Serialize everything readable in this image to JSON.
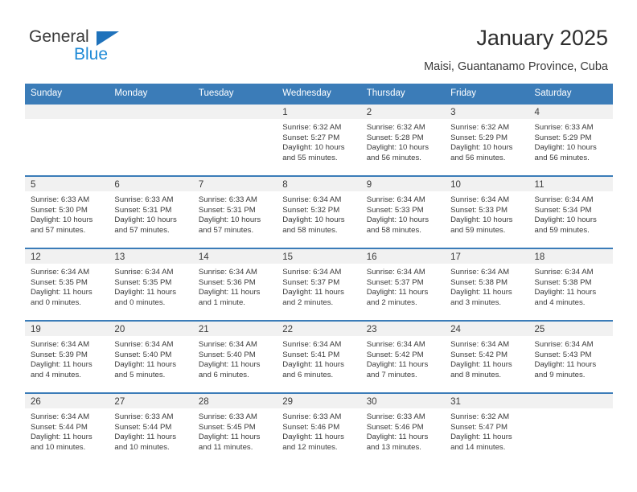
{
  "brand": {
    "name_part1": "General",
    "name_part2": "Blue",
    "triangle_icon": "triangle-icon",
    "accent_dark": "#1f72bb",
    "accent_light": "#1f8ad6"
  },
  "header": {
    "title": "January 2025",
    "subtitle": "Maisi, Guantanamo Province, Cuba"
  },
  "colors": {
    "header_band": "#3b7cb8",
    "day_band": "#f1f1f1",
    "text": "#3a3a3a"
  },
  "weekdays": [
    "Sunday",
    "Monday",
    "Tuesday",
    "Wednesday",
    "Thursday",
    "Friday",
    "Saturday"
  ],
  "weeks": [
    [
      {
        "day": "",
        "sunrise": "",
        "sunset": "",
        "daylight": "",
        "daylight2": ""
      },
      {
        "day": "",
        "sunrise": "",
        "sunset": "",
        "daylight": "",
        "daylight2": ""
      },
      {
        "day": "",
        "sunrise": "",
        "sunset": "",
        "daylight": "",
        "daylight2": ""
      },
      {
        "day": "1",
        "sunrise": "Sunrise: 6:32 AM",
        "sunset": "Sunset: 5:27 PM",
        "daylight": "Daylight: 10 hours",
        "daylight2": "and 55 minutes."
      },
      {
        "day": "2",
        "sunrise": "Sunrise: 6:32 AM",
        "sunset": "Sunset: 5:28 PM",
        "daylight": "Daylight: 10 hours",
        "daylight2": "and 56 minutes."
      },
      {
        "day": "3",
        "sunrise": "Sunrise: 6:32 AM",
        "sunset": "Sunset: 5:29 PM",
        "daylight": "Daylight: 10 hours",
        "daylight2": "and 56 minutes."
      },
      {
        "day": "4",
        "sunrise": "Sunrise: 6:33 AM",
        "sunset": "Sunset: 5:29 PM",
        "daylight": "Daylight: 10 hours",
        "daylight2": "and 56 minutes."
      }
    ],
    [
      {
        "day": "5",
        "sunrise": "Sunrise: 6:33 AM",
        "sunset": "Sunset: 5:30 PM",
        "daylight": "Daylight: 10 hours",
        "daylight2": "and 57 minutes."
      },
      {
        "day": "6",
        "sunrise": "Sunrise: 6:33 AM",
        "sunset": "Sunset: 5:31 PM",
        "daylight": "Daylight: 10 hours",
        "daylight2": "and 57 minutes."
      },
      {
        "day": "7",
        "sunrise": "Sunrise: 6:33 AM",
        "sunset": "Sunset: 5:31 PM",
        "daylight": "Daylight: 10 hours",
        "daylight2": "and 57 minutes."
      },
      {
        "day": "8",
        "sunrise": "Sunrise: 6:34 AM",
        "sunset": "Sunset: 5:32 PM",
        "daylight": "Daylight: 10 hours",
        "daylight2": "and 58 minutes."
      },
      {
        "day": "9",
        "sunrise": "Sunrise: 6:34 AM",
        "sunset": "Sunset: 5:33 PM",
        "daylight": "Daylight: 10 hours",
        "daylight2": "and 58 minutes."
      },
      {
        "day": "10",
        "sunrise": "Sunrise: 6:34 AM",
        "sunset": "Sunset: 5:33 PM",
        "daylight": "Daylight: 10 hours",
        "daylight2": "and 59 minutes."
      },
      {
        "day": "11",
        "sunrise": "Sunrise: 6:34 AM",
        "sunset": "Sunset: 5:34 PM",
        "daylight": "Daylight: 10 hours",
        "daylight2": "and 59 minutes."
      }
    ],
    [
      {
        "day": "12",
        "sunrise": "Sunrise: 6:34 AM",
        "sunset": "Sunset: 5:35 PM",
        "daylight": "Daylight: 11 hours",
        "daylight2": "and 0 minutes."
      },
      {
        "day": "13",
        "sunrise": "Sunrise: 6:34 AM",
        "sunset": "Sunset: 5:35 PM",
        "daylight": "Daylight: 11 hours",
        "daylight2": "and 0 minutes."
      },
      {
        "day": "14",
        "sunrise": "Sunrise: 6:34 AM",
        "sunset": "Sunset: 5:36 PM",
        "daylight": "Daylight: 11 hours",
        "daylight2": "and 1 minute."
      },
      {
        "day": "15",
        "sunrise": "Sunrise: 6:34 AM",
        "sunset": "Sunset: 5:37 PM",
        "daylight": "Daylight: 11 hours",
        "daylight2": "and 2 minutes."
      },
      {
        "day": "16",
        "sunrise": "Sunrise: 6:34 AM",
        "sunset": "Sunset: 5:37 PM",
        "daylight": "Daylight: 11 hours",
        "daylight2": "and 2 minutes."
      },
      {
        "day": "17",
        "sunrise": "Sunrise: 6:34 AM",
        "sunset": "Sunset: 5:38 PM",
        "daylight": "Daylight: 11 hours",
        "daylight2": "and 3 minutes."
      },
      {
        "day": "18",
        "sunrise": "Sunrise: 6:34 AM",
        "sunset": "Sunset: 5:38 PM",
        "daylight": "Daylight: 11 hours",
        "daylight2": "and 4 minutes."
      }
    ],
    [
      {
        "day": "19",
        "sunrise": "Sunrise: 6:34 AM",
        "sunset": "Sunset: 5:39 PM",
        "daylight": "Daylight: 11 hours",
        "daylight2": "and 4 minutes."
      },
      {
        "day": "20",
        "sunrise": "Sunrise: 6:34 AM",
        "sunset": "Sunset: 5:40 PM",
        "daylight": "Daylight: 11 hours",
        "daylight2": "and 5 minutes."
      },
      {
        "day": "21",
        "sunrise": "Sunrise: 6:34 AM",
        "sunset": "Sunset: 5:40 PM",
        "daylight": "Daylight: 11 hours",
        "daylight2": "and 6 minutes."
      },
      {
        "day": "22",
        "sunrise": "Sunrise: 6:34 AM",
        "sunset": "Sunset: 5:41 PM",
        "daylight": "Daylight: 11 hours",
        "daylight2": "and 6 minutes."
      },
      {
        "day": "23",
        "sunrise": "Sunrise: 6:34 AM",
        "sunset": "Sunset: 5:42 PM",
        "daylight": "Daylight: 11 hours",
        "daylight2": "and 7 minutes."
      },
      {
        "day": "24",
        "sunrise": "Sunrise: 6:34 AM",
        "sunset": "Sunset: 5:42 PM",
        "daylight": "Daylight: 11 hours",
        "daylight2": "and 8 minutes."
      },
      {
        "day": "25",
        "sunrise": "Sunrise: 6:34 AM",
        "sunset": "Sunset: 5:43 PM",
        "daylight": "Daylight: 11 hours",
        "daylight2": "and 9 minutes."
      }
    ],
    [
      {
        "day": "26",
        "sunrise": "Sunrise: 6:34 AM",
        "sunset": "Sunset: 5:44 PM",
        "daylight": "Daylight: 11 hours",
        "daylight2": "and 10 minutes."
      },
      {
        "day": "27",
        "sunrise": "Sunrise: 6:33 AM",
        "sunset": "Sunset: 5:44 PM",
        "daylight": "Daylight: 11 hours",
        "daylight2": "and 10 minutes."
      },
      {
        "day": "28",
        "sunrise": "Sunrise: 6:33 AM",
        "sunset": "Sunset: 5:45 PM",
        "daylight": "Daylight: 11 hours",
        "daylight2": "and 11 minutes."
      },
      {
        "day": "29",
        "sunrise": "Sunrise: 6:33 AM",
        "sunset": "Sunset: 5:46 PM",
        "daylight": "Daylight: 11 hours",
        "daylight2": "and 12 minutes."
      },
      {
        "day": "30",
        "sunrise": "Sunrise: 6:33 AM",
        "sunset": "Sunset: 5:46 PM",
        "daylight": "Daylight: 11 hours",
        "daylight2": "and 13 minutes."
      },
      {
        "day": "31",
        "sunrise": "Sunrise: 6:32 AM",
        "sunset": "Sunset: 5:47 PM",
        "daylight": "Daylight: 11 hours",
        "daylight2": "and 14 minutes."
      },
      {
        "day": "",
        "sunrise": "",
        "sunset": "",
        "daylight": "",
        "daylight2": ""
      }
    ]
  ]
}
